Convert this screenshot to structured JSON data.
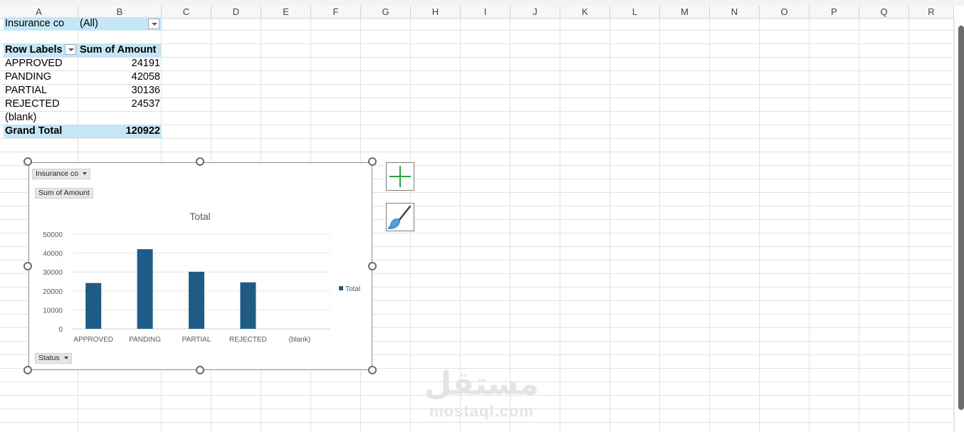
{
  "columns": [
    "A",
    "B",
    "C",
    "D",
    "E",
    "F",
    "G",
    "H",
    "I",
    "J",
    "K",
    "L",
    "M",
    "N",
    "O",
    "P",
    "Q",
    "R"
  ],
  "pivot": {
    "filter_label": "Insurance co",
    "filter_value": "(All)",
    "row_labels_header": "Row Labels",
    "sum_header": "Sum of Amount",
    "rows": [
      {
        "label": "APPROVED",
        "value": "24191"
      },
      {
        "label": "PANDING",
        "value": "42058"
      },
      {
        "label": "PARTIAL",
        "value": "30136"
      },
      {
        "label": "REJECTED",
        "value": "24537"
      },
      {
        "label": "(blank)",
        "value": ""
      }
    ],
    "grand_total_label": "Grand Total",
    "grand_total_value": "120922"
  },
  "chart": {
    "filter_button": "Insurance co",
    "value_button": "Sum of Amount",
    "axis_button": "Status",
    "accent": "#1f5c85"
  },
  "chart_data": {
    "type": "bar",
    "title": "Total",
    "categories": [
      "APPROVED",
      "PANDING",
      "PARTIAL",
      "REJECTED",
      "(blank)"
    ],
    "series": [
      {
        "name": "Total",
        "values": [
          24191,
          42058,
          30136,
          24537,
          null
        ]
      }
    ],
    "ylim": [
      0,
      50000
    ],
    "yticks": [
      0,
      10000,
      20000,
      30000,
      40000,
      50000
    ],
    "grid": true,
    "legend": "right"
  },
  "side_buttons": {
    "add_icon": "plus-icon",
    "style_icon": "brush-icon"
  },
  "watermark": {
    "arabic": "مستقل",
    "latin": "mostaql.com"
  }
}
